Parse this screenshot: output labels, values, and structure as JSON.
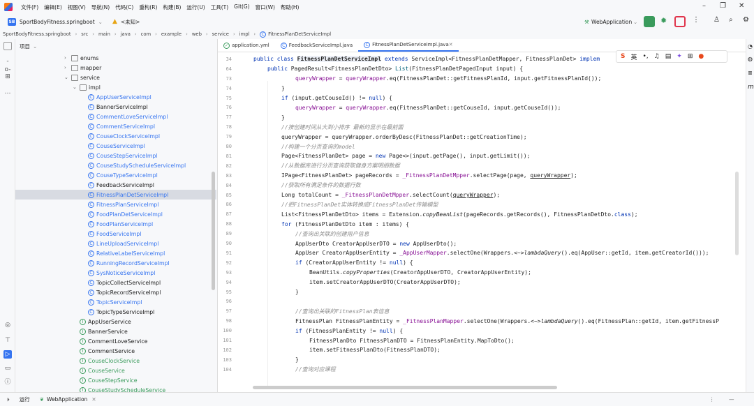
{
  "menubar": {
    "items": [
      "文件(F)",
      "编辑(E)",
      "视图(V)",
      "导航(N)",
      "代码(C)",
      "重构(R)",
      "构建(B)",
      "运行(U)",
      "工具(T)",
      "Git(G)",
      "窗口(W)",
      "帮助(H)"
    ]
  },
  "toolbar": {
    "project_badge": "SB",
    "project_name": "SportBodyFitness.springboot",
    "vcs_label": "<未知>",
    "run_config": "WebApplication"
  },
  "breadcrumb": [
    "SportBodyFitness.springboot",
    "src",
    "main",
    "java",
    "com",
    "example",
    "web",
    "service",
    "impl",
    "FitnessPlanDetServiceImpl"
  ],
  "project_panel": {
    "title": "项目",
    "tree": [
      {
        "label": "enums",
        "type": "folder",
        "indent": 0,
        "chev": "›"
      },
      {
        "label": "mapper",
        "type": "folder",
        "indent": 0,
        "chev": "›"
      },
      {
        "label": "service",
        "type": "folder",
        "indent": 0,
        "chev": "⌄"
      },
      {
        "label": "impl",
        "type": "folder",
        "indent": 1,
        "chev": "⌄"
      },
      {
        "label": "AppUserServiceImpl",
        "type": "class",
        "indent": 2,
        "color": "blue"
      },
      {
        "label": "BannerServiceImpl",
        "type": "class",
        "indent": 2,
        "color": "dark"
      },
      {
        "label": "CommentLoveServiceImpl",
        "type": "class",
        "indent": 2,
        "color": "blue"
      },
      {
        "label": "CommentServiceImpl",
        "type": "class",
        "indent": 2,
        "color": "blue"
      },
      {
        "label": "CouseClockServiceImpl",
        "type": "class",
        "indent": 2,
        "color": "blue"
      },
      {
        "label": "CouseServiceImpl",
        "type": "class",
        "indent": 2,
        "color": "blue"
      },
      {
        "label": "CouseStepServiceImpl",
        "type": "class",
        "indent": 2,
        "color": "blue"
      },
      {
        "label": "CouseStudyScheduleServiceImpl",
        "type": "class",
        "indent": 2,
        "color": "blue"
      },
      {
        "label": "CouseTypeServiceImpl",
        "type": "class",
        "indent": 2,
        "color": "blue"
      },
      {
        "label": "FeedbackServiceImpl",
        "type": "class",
        "indent": 2,
        "color": "dark"
      },
      {
        "label": "FitnessPlanDetServiceImpl",
        "type": "class",
        "indent": 2,
        "color": "blue",
        "selected": true
      },
      {
        "label": "FitnessPlanServiceImpl",
        "type": "class",
        "indent": 2,
        "color": "blue"
      },
      {
        "label": "FoodPlanDetServiceImpl",
        "type": "class",
        "indent": 2,
        "color": "blue"
      },
      {
        "label": "FoodPlanServiceImpl",
        "type": "class",
        "indent": 2,
        "color": "blue"
      },
      {
        "label": "FoodServiceImpl",
        "type": "class",
        "indent": 2,
        "color": "blue"
      },
      {
        "label": "LineUploadServiceImpl",
        "type": "class",
        "indent": 2,
        "color": "blue"
      },
      {
        "label": "RelativeLabelServiceImpl",
        "type": "class",
        "indent": 2,
        "color": "blue"
      },
      {
        "label": "RunningRecordServiceImpl",
        "type": "class",
        "indent": 2,
        "color": "blue"
      },
      {
        "label": "SysNoticeServiceImpl",
        "type": "class",
        "indent": 2,
        "color": "blue"
      },
      {
        "label": "TopicCollectServiceImpl",
        "type": "class",
        "indent": 2,
        "color": "dark"
      },
      {
        "label": "TopicRecordServiceImpl",
        "type": "class",
        "indent": 2,
        "color": "dark"
      },
      {
        "label": "TopicServiceImpl",
        "type": "class",
        "indent": 2,
        "color": "blue"
      },
      {
        "label": "TopicTypeServiceImpl",
        "type": "class",
        "indent": 2,
        "color": "dark"
      },
      {
        "label": "AppUserService",
        "type": "interface",
        "indent": 1,
        "color": "dark"
      },
      {
        "label": "BannerService",
        "type": "interface",
        "indent": 1,
        "color": "dark"
      },
      {
        "label": "CommentLoveService",
        "type": "interface",
        "indent": 1,
        "color": "dark"
      },
      {
        "label": "CommentService",
        "type": "interface",
        "indent": 1,
        "color": "dark"
      },
      {
        "label": "CouseClockService",
        "type": "interface",
        "indent": 1,
        "color": "green"
      },
      {
        "label": "CouseService",
        "type": "interface",
        "indent": 1,
        "color": "green"
      },
      {
        "label": "CouseStepService",
        "type": "interface",
        "indent": 1,
        "color": "green"
      },
      {
        "label": "CouseStudyScheduleService",
        "type": "interface",
        "indent": 1,
        "color": "green"
      }
    ]
  },
  "editor": {
    "tabs": [
      {
        "label": "application.yml",
        "active": false
      },
      {
        "label": "FeedbackServiceImpl.java",
        "active": false
      },
      {
        "label": "FitnessPlanDetServiceImpl.java",
        "active": true
      }
    ],
    "lines": [
      {
        "n": "34",
        "html": "<span class='kw'>public class</span> <b style='background:#edf0f7'>FitnessPlanDetServiceImpl</b> <span class='kw'>extends</span> ServiceImpl&lt;FitnessPlanDetMapper, FitnessPlanDet&gt; <span class='kw'>implem</span>",
        "indent": 0
      },
      {
        "n": "64",
        "html": "<span class='kw'>public</span> PagedResult&lt;FitnessPlanDetDto&gt; <span class='fn'>List</span>(FitnessPlanDetPagedInput input) {",
        "indent": 1
      },
      {
        "n": "73",
        "html": "<span class='fld'>queryWrapper</span> = <span class='fld'>queryWrapper</span>.eq(FitnessPlanDet::getFitnessPlanId, input.getFitnessPlanId());",
        "indent": 3
      },
      {
        "n": "74",
        "html": "}",
        "indent": 2
      },
      {
        "n": "75",
        "html": "<span class='kw'>if</span> (input.getCouseId() != <span class='kw'>null</span>) {",
        "indent": 2
      },
      {
        "n": "76",
        "html": "<span class='fld'>queryWrapper</span> = <span class='fld'>queryWrapper</span>.eq(FitnessPlanDet::getCouseId, input.getCouseId());",
        "indent": 3
      },
      {
        "n": "77",
        "html": "}",
        "indent": 2
      },
      {
        "n": "78",
        "html": "<span class='cm'>//按创建时间从大到小排序 最新的显示在最前面</span>",
        "indent": 2
      },
      {
        "n": "79",
        "html": "queryWrapper = queryWrapper.orderByDesc(FitnessPlanDet::getCreationTime);",
        "indent": 2
      },
      {
        "n": "80",
        "html": "<span class='cm'>//构建一个分页查询的model</span>",
        "indent": 2
      },
      {
        "n": "81",
        "html": "Page&lt;FitnessPlanDet&gt; page = <span class='kw'>new</span> Page&lt;&gt;(input.getPage(), input.getLimit());",
        "indent": 2
      },
      {
        "n": "82",
        "html": "<span class='cm'>//从数据库进行分页查询获取健身方案明细数据</span>",
        "indent": 2
      },
      {
        "n": "83",
        "html": "IPage&lt;FitnessPlanDet&gt; pageRecords = <span class='fld'>_FitnessPlanDetMpper</span>.selectPage(page, <u>queryWrapper</u>);",
        "indent": 2
      },
      {
        "n": "84",
        "html": "<span class='cm'>//获取所有满足条件的数据行数</span>",
        "indent": 2
      },
      {
        "n": "85",
        "html": "Long totalCount = <span class='fld'>_FitnessPlanDetMpper</span>.selectCount(<u>queryWrapper</u>);",
        "indent": 2
      },
      {
        "n": "86",
        "html": "<span class='cm'>//把FitnessPlanDet实体转换成FitnessPlanDet传输模型</span>",
        "indent": 2
      },
      {
        "n": "87",
        "html": "List&lt;FitnessPlanDetDto&gt; items = Extension.<span class='it'>copyBeanList</span>(pageRecords.getRecords(), FitnessPlanDetDto.<span class='kw'>class</span>);",
        "indent": 2
      },
      {
        "n": "88",
        "html": "<span class='kw'>for</span> (FitnessPlanDetDto item : items) {",
        "indent": 2
      },
      {
        "n": "89",
        "html": "<span class='cm'>//查询出关联的创建用户信息</span>",
        "indent": 3
      },
      {
        "n": "90",
        "html": "AppUserDto CreatorAppUserDTO = <span class='kw'>new</span> AppUserDto();",
        "indent": 3
      },
      {
        "n": "91",
        "html": "AppUser CreatorAppUserEntity = <span class='fld'>_AppUserMapper</span>.selectOne(Wrappers.&lt;~&gt;<span class='it'>lambdaQuery</span>().eq(AppUser::getId, item.getCreatorId()));",
        "indent": 3
      },
      {
        "n": "92",
        "html": "<span class='kw'>if</span> (CreatorAppUserEntity != <span class='kw'>null</span>) {",
        "indent": 3
      },
      {
        "n": "93",
        "html": "BeanUtils.<span class='it'>copyProperties</span>(CreatorAppUserDTO, CreatorAppUserEntity);",
        "indent": 4
      },
      {
        "n": "94",
        "html": "item.setCreatorAppUserDTO(CreatorAppUserDTO);",
        "indent": 4
      },
      {
        "n": "95",
        "html": "}",
        "indent": 3
      },
      {
        "n": "96",
        "html": "",
        "indent": 0
      },
      {
        "n": "97",
        "html": "<span class='cm'>//查询出关联的FitnessPlan表信息</span>",
        "indent": 3
      },
      {
        "n": "98",
        "html": "FitnessPlan FitnessPlanEntity = <span class='fld'>_FitnessPlanMapper</span>.selectOne(Wrappers.&lt;~&gt;<span class='it'>lambdaQuery</span>().eq(FitnessPlan::getId, item.getFitnessP",
        "indent": 3
      },
      {
        "n": "100",
        "html": "<span class='kw'>if</span> (FitnessPlanEntity != <span class='kw'>null</span>) {",
        "indent": 3
      },
      {
        "n": "101",
        "html": "FitnessPlanDto FitnessPlanDTO = FitnessPlanEntity.MapToDto();",
        "indent": 4
      },
      {
        "n": "102",
        "html": "item.setFitnessPlanDto(FitnessPlanDTO);",
        "indent": 4
      },
      {
        "n": "103",
        "html": "}",
        "indent": 3
      },
      {
        "n": "104",
        "html": "<span class='cm'>//查询对应课程</span>",
        "indent": 3
      }
    ]
  },
  "status": {
    "run_label": "运行",
    "run_config": "WebApplication"
  },
  "colors": {
    "accent": "#3574f0",
    "bg": "#f7f8fa"
  }
}
